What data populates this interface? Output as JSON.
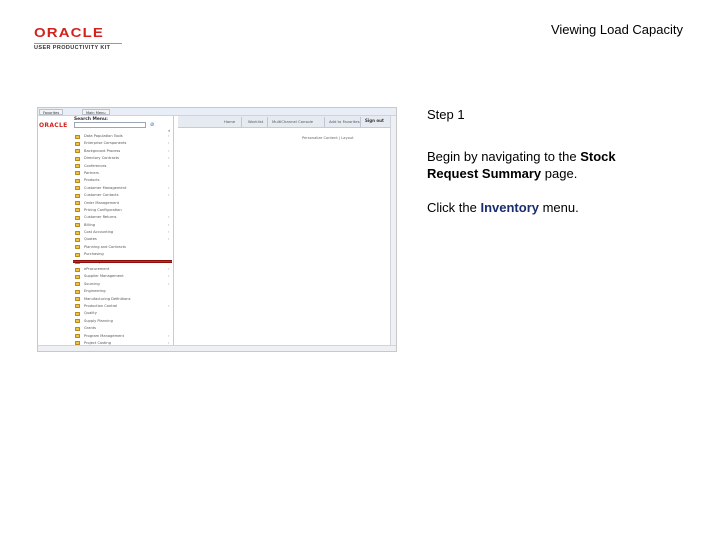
{
  "logo": {
    "brand": "ORACLE",
    "sub": "USER PRODUCTIVITY KIT"
  },
  "doc_title": "Viewing Load Capacity",
  "screenshot": {
    "tabs": [
      "Favorites",
      "Main Menu"
    ],
    "brand": "ORACLE",
    "header_links": [
      "Home",
      "Worklist",
      "MultiChannel Console",
      "Add to Favorites",
      "Sign out"
    ],
    "personalize": "Personalize Content | Layout",
    "menu_title": "Search Menu:",
    "search_go": "⊘",
    "collapse": "«",
    "menu_items": [
      {
        "label": "Data Population Tools",
        "arrow": "›"
      },
      {
        "label": "Enterprise Components",
        "arrow": "›"
      },
      {
        "label": "Background Process",
        "arrow": "›"
      },
      {
        "label": "Directory Contracts",
        "arrow": "›"
      },
      {
        "label": "Conferences",
        "arrow": "›"
      },
      {
        "label": "Partners",
        "arrow": ""
      },
      {
        "label": "Products",
        "arrow": ""
      },
      {
        "label": "Customer Management",
        "arrow": "›"
      },
      {
        "label": "Customer Contacts",
        "arrow": "›"
      },
      {
        "label": "Order Management",
        "arrow": ""
      },
      {
        "label": "Pricing Configuration",
        "arrow": ""
      },
      {
        "label": "Customer Returns",
        "arrow": "›"
      },
      {
        "label": "Billing",
        "arrow": "›"
      },
      {
        "label": "Cost Accounting",
        "arrow": "›"
      },
      {
        "label": "Quotes",
        "arrow": "›"
      },
      {
        "label": "Planning and Contracts",
        "arrow": ""
      },
      {
        "label": "Purchasing",
        "arrow": ""
      },
      {
        "label": "Inventory",
        "arrow": ""
      },
      {
        "label": "eProcurement",
        "arrow": "›"
      },
      {
        "label": "Supplier Management",
        "arrow": "›"
      },
      {
        "label": "Sourcing",
        "arrow": "›"
      },
      {
        "label": "Engineering",
        "arrow": ""
      },
      {
        "label": "Manufacturing Definitions",
        "arrow": ""
      },
      {
        "label": "Production Control",
        "arrow": "›"
      },
      {
        "label": "Quality",
        "arrow": ""
      },
      {
        "label": "Supply Planning",
        "arrow": ""
      },
      {
        "label": "Grants",
        "arrow": ""
      },
      {
        "label": "Program Management",
        "arrow": "›"
      },
      {
        "label": "Project Costing",
        "arrow": "›"
      }
    ]
  },
  "step": "Step 1",
  "instruction": {
    "pre": "Begin by navigating to the ",
    "bold": "Stock Request Summary",
    "post": " page."
  },
  "instruction2": {
    "pre": "Click the ",
    "bold": "Inventory",
    "post": " menu."
  },
  "colors": {
    "oracle_red": "#d2231e",
    "highlight": "#d91e18",
    "inventory_text": "#1a2d6e"
  }
}
